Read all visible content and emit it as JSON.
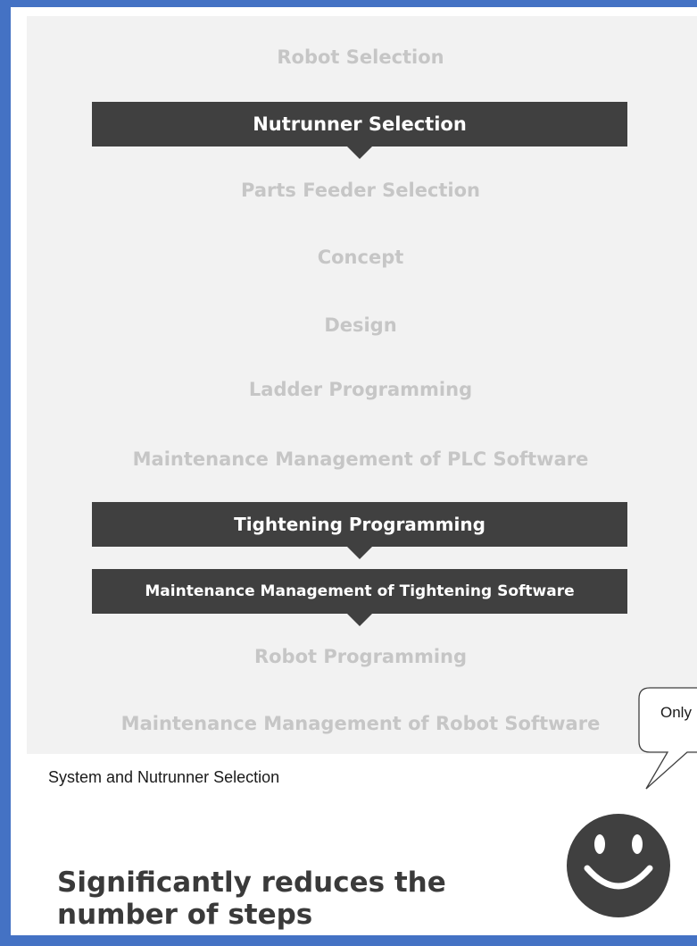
{
  "steps": [
    {
      "label": "Robot Selection",
      "highlighted": false
    },
    {
      "label": "Nutrunner Selection",
      "highlighted": true
    },
    {
      "label": "Parts Feeder Selection",
      "highlighted": false
    },
    {
      "label": "Concept",
      "highlighted": false
    },
    {
      "label": "Design",
      "highlighted": false
    },
    {
      "label": "Ladder Programming",
      "highlighted": false
    },
    {
      "label": "Maintenance Management of PLC Software",
      "highlighted": false
    },
    {
      "label": "Tightening Programming",
      "highlighted": true
    },
    {
      "label": "Maintenance Management of Tightening Software",
      "highlighted": true
    },
    {
      "label": "Robot Programming",
      "highlighted": false
    },
    {
      "label": "Maintenance Management of Robot Software",
      "highlighted": false
    }
  ],
  "caption": "System and Nutrunner Selection",
  "callout": "Only",
  "headline": "Significantly reduces the number of steps",
  "colors": {
    "frame": "#4472c4",
    "panel": "#f2f2f2",
    "highlight_bar": "#404040",
    "dimmed_text": "#c6c6c6",
    "smiley": "#404040"
  },
  "icons": [
    "smiley-face-icon",
    "speech-bubble-icon",
    "down-arrow-icon"
  ]
}
